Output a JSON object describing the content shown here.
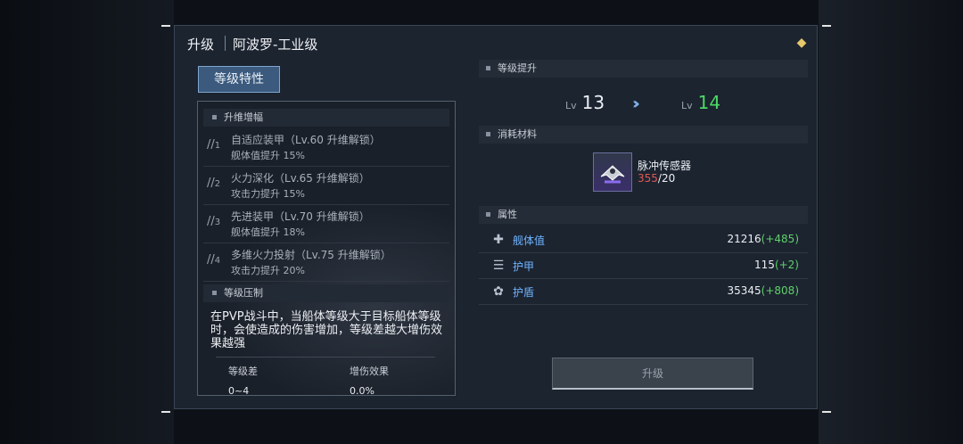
{
  "header": {
    "title": "升级",
    "ship_name": "阿波罗-工业级"
  },
  "tabs": {
    "active_label": "等级特性"
  },
  "left": {
    "section1_title": "升维增幅",
    "items": [
      {
        "num": "1",
        "line1": "自适应装甲（Lv.60 升维解锁）",
        "line2": "舰体值提升 15%"
      },
      {
        "num": "2",
        "line1": "火力深化（Lv.65 升维解锁）",
        "line2": "攻击力提升 15%"
      },
      {
        "num": "3",
        "line1": "先进装甲（Lv.70 升维解锁）",
        "line2": "舰体值提升 18%"
      },
      {
        "num": "4",
        "line1": "多维火力投射（Lv.75 升维解锁）",
        "line2": "攻击力提升 20%"
      }
    ],
    "section2_title": "等级压制",
    "description": "在PVP战斗中，当船体等级大于目标船体等级时，会使造成的伤害增加，等级差越大增伤效果越强",
    "table": {
      "headers": [
        "等级差",
        "增伤效果"
      ],
      "rows": [
        [
          "0~4",
          "0.0%"
        ]
      ]
    }
  },
  "right": {
    "level_section_title": "等级提升",
    "lv_prefix": "Lv",
    "current_level": "13",
    "next_level": "14",
    "material_section_title": "消耗材料",
    "material": {
      "name": "脉冲传感器",
      "have": "355",
      "need": "/20"
    },
    "attr_section_title": "属性",
    "attributes": [
      {
        "icon": "hull-icon",
        "name": "舰体值",
        "value": "21216",
        "inc": "(+485)"
      },
      {
        "icon": "armor-icon",
        "name": "护甲",
        "value": "115",
        "inc": "(+2)"
      },
      {
        "icon": "shield-icon",
        "name": "护盾",
        "value": "35345",
        "inc": "(+808)"
      }
    ],
    "upgrade_button": "升级"
  },
  "colors": {
    "accent_blue": "#6fb4ff",
    "increase_green": "#5fd06a",
    "next_level_green": "#4cd964",
    "insufficient_red": "#e05a55"
  }
}
